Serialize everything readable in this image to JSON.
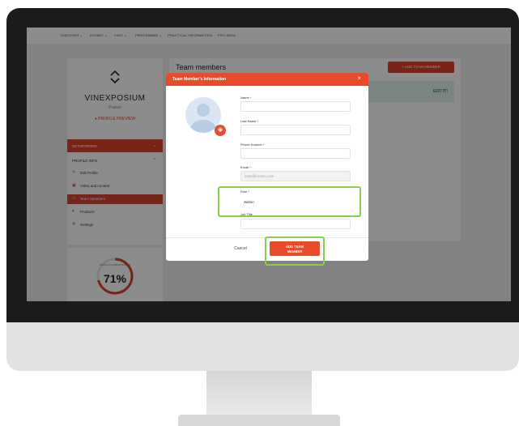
{
  "nav": {
    "items": [
      "DISCOVER ⌄",
      "EXHIBIT ⌄",
      "VISIT ⌄",
      "PROGRAMME ⌄",
      "PRACTICAL INFORMATION",
      "PRO AREA"
    ]
  },
  "profile": {
    "brand": "VINEXPOSIUM",
    "country": "France",
    "preview_label": "PROFILE PREVIEW",
    "networking_label": "NETWORKING",
    "profile_info_label": "PROFILE INFO",
    "menu": [
      {
        "label": "Edit Profile",
        "icon": "pencil-icon"
      },
      {
        "label": "Video and content",
        "icon": "video-icon"
      },
      {
        "label": "Team Members",
        "icon": "team-icon",
        "active": true
      },
      {
        "label": "Products",
        "icon": "product-icon"
      },
      {
        "label": "Settings",
        "icon": "gear-icon"
      }
    ],
    "completion_label": "PROFILE COMPLETENESS",
    "completion_value": "71%",
    "completion_fraction": 0.71
  },
  "team": {
    "title": "Team members",
    "add_button": "+ ADD TEAM MEMBER",
    "banner_action": "GOT IT!"
  },
  "modal": {
    "title": "Team Member's Information",
    "close": "×",
    "fields": {
      "name_label": "Name *",
      "last_name_label": "Last Name *",
      "phone_label": "Phone Number *",
      "email_label": "Email *",
      "email_value": "taste@moms.com",
      "role_label": "Role *",
      "role_value": "Admin",
      "job_title_label": "Job Title"
    },
    "cancel_label": "Cancel",
    "submit_line1": "ADD TEAM",
    "submit_line2": "MEMBER"
  },
  "colors": {
    "accent": "#e84a2c",
    "highlight": "#8ccb4c"
  }
}
